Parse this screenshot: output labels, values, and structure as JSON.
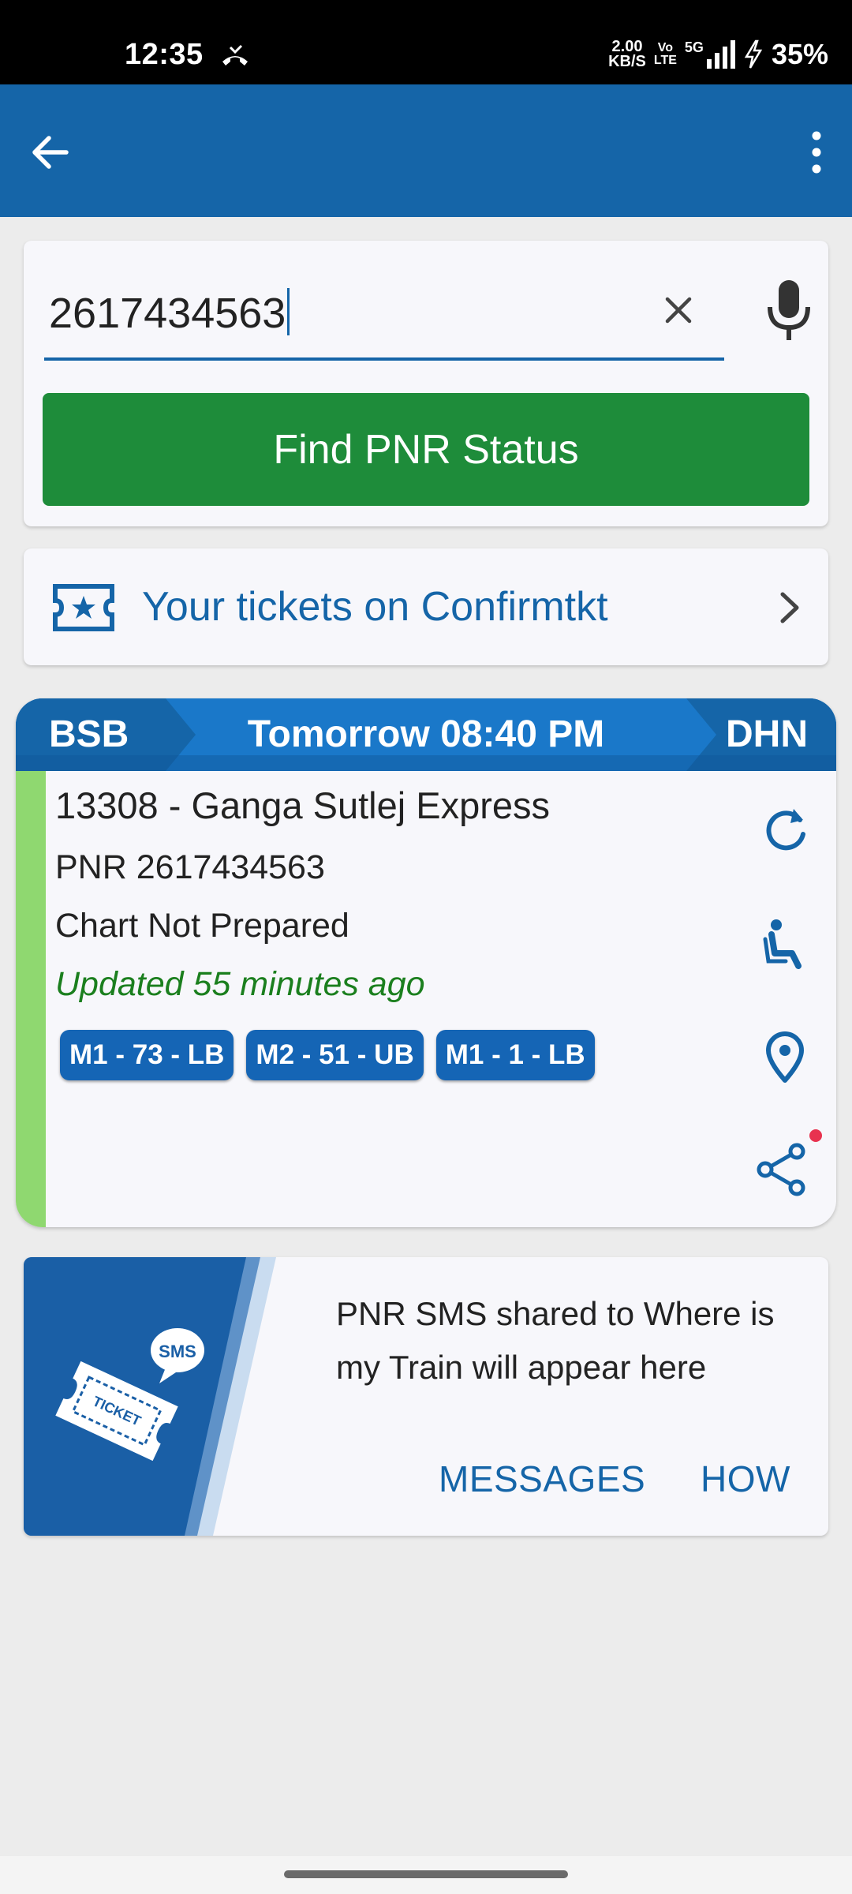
{
  "status_bar": {
    "time": "12:35",
    "speed_value": "2.00",
    "speed_unit": "KB/S",
    "volte_top": "Vo",
    "volte_bottom": "LTE",
    "network": "5G",
    "battery": "35%"
  },
  "search": {
    "value": "2617434563",
    "find_button_label": "Find PNR Status"
  },
  "tickets_link": {
    "label": "Your tickets on Confirmtkt"
  },
  "pnr_card": {
    "from": "BSB",
    "departure": "Tomorrow 08:40 PM",
    "to": "DHN",
    "train": "13308 - Ganga Sutlej Express",
    "pnr": "PNR 2617434563",
    "chart_status": "Chart Not Prepared",
    "updated": "Updated 55 minutes ago",
    "berths": [
      "M1 - 73 - LB",
      "M2 - 51 - UB",
      "M1 - 1 - LB"
    ]
  },
  "sms_card": {
    "badge": "SMS",
    "ticket_word": "TICKET",
    "message": "PNR SMS shared to Where is my Train will appear here",
    "messages_button": "MESSAGES",
    "how_button": "HOW"
  },
  "colors": {
    "primary": "#1565a8",
    "find_button": "#1e8c3a",
    "updated_text": "#1b7f1e",
    "status_strip": "#8fd870",
    "notification_dot": "#e8324f"
  }
}
